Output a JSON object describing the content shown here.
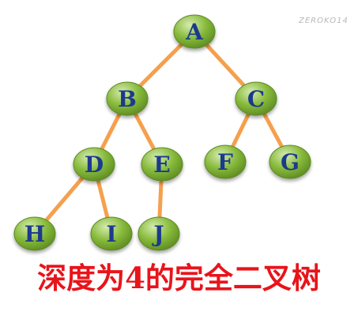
{
  "watermark": "ZEROKO14",
  "caption": "深度为4的完全二叉树",
  "colors": {
    "edge": "#f5a04d",
    "node_fill": "#86b93a",
    "node_fill_light": "#d6ecb0",
    "node_stroke": "#5d8a22",
    "label": "#1c3a8c",
    "caption": "#e8141b"
  },
  "tree": {
    "nodes": [
      {
        "id": "A",
        "label": "A",
        "depth": 1
      },
      {
        "id": "B",
        "label": "B",
        "depth": 2
      },
      {
        "id": "C",
        "label": "C",
        "depth": 2
      },
      {
        "id": "D",
        "label": "D",
        "depth": 3
      },
      {
        "id": "E",
        "label": "E",
        "depth": 3
      },
      {
        "id": "F",
        "label": "F",
        "depth": 3
      },
      {
        "id": "G",
        "label": "G",
        "depth": 3
      },
      {
        "id": "H",
        "label": "H",
        "depth": 4
      },
      {
        "id": "I",
        "label": "I",
        "depth": 4
      },
      {
        "id": "J",
        "label": "J",
        "depth": 4
      }
    ],
    "edges": [
      {
        "from": "A",
        "to": "B"
      },
      {
        "from": "A",
        "to": "C"
      },
      {
        "from": "B",
        "to": "D"
      },
      {
        "from": "B",
        "to": "E"
      },
      {
        "from": "C",
        "to": "F"
      },
      {
        "from": "C",
        "to": "G"
      },
      {
        "from": "D",
        "to": "H"
      },
      {
        "from": "D",
        "to": "I"
      },
      {
        "from": "E",
        "to": "J"
      }
    ]
  }
}
